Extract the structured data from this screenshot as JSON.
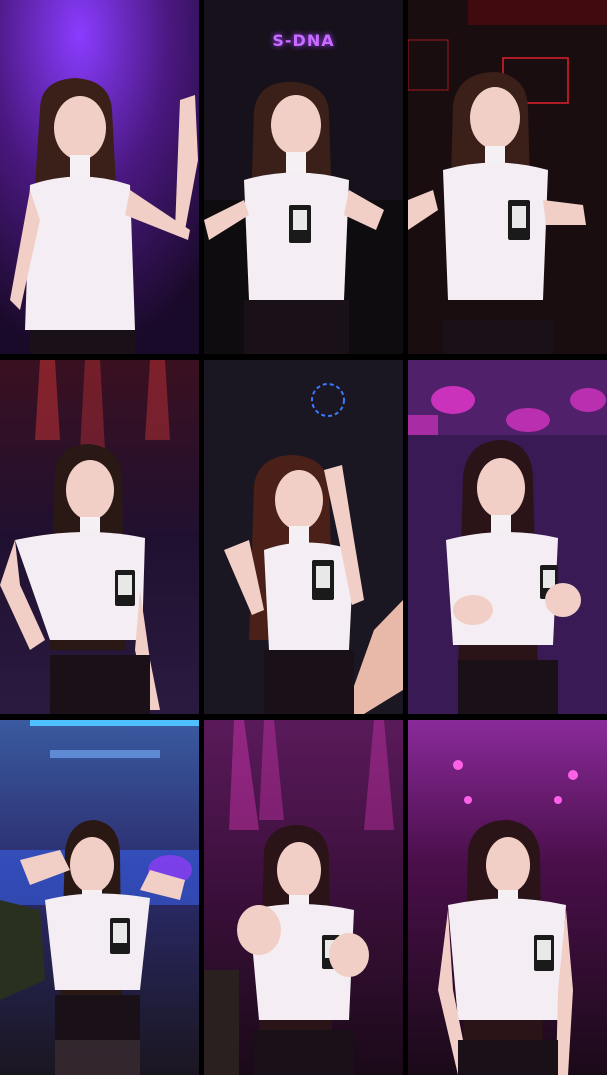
{
  "grid": {
    "rows": 3,
    "columns": 3,
    "tiles": [
      {
        "id": "tile-1",
        "background": "#5a1a9a",
        "light": "#8a3cff"
      },
      {
        "id": "tile-2",
        "background": "#17111c",
        "light": "#3a2440",
        "sign_text": "S-DNA"
      },
      {
        "id": "tile-3",
        "background": "#1a0d10",
        "light": "#e0202a"
      },
      {
        "id": "tile-4",
        "background": "#1f1030",
        "light": "#e33a3a"
      },
      {
        "id": "tile-5",
        "background": "#1a1622",
        "light": "#3a7aff"
      },
      {
        "id": "tile-6",
        "background": "#3a1a55",
        "light": "#ff3ae0"
      },
      {
        "id": "tile-7",
        "background": "#2a2a6a",
        "light": "#3a6aff"
      },
      {
        "id": "tile-8",
        "background": "#3a0f3a",
        "light": "#ff40d0"
      },
      {
        "id": "tile-9",
        "background": "#4a0f4a",
        "light": "#ff60e8"
      }
    ]
  }
}
